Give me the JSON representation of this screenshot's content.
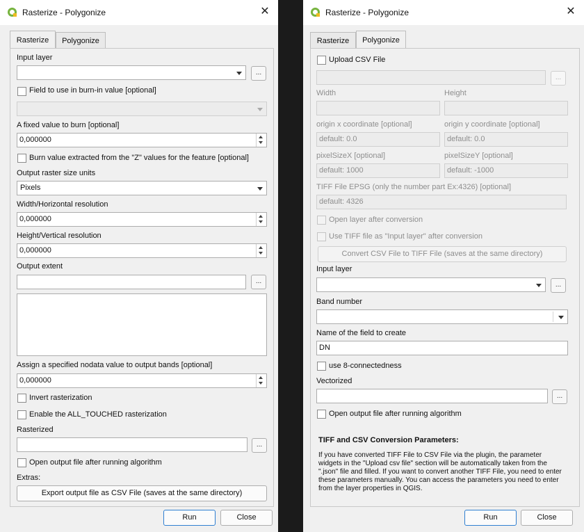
{
  "left_window": {
    "title": "Rasterize - Polygonize",
    "close_glyph": "✕",
    "tabs": [
      "Rasterize",
      "Polygonize"
    ],
    "input_layer_label": "Input layer",
    "input_layer_value": "",
    "browse_label": "...",
    "browse_extent_label": "...",
    "field_burn_label": "Field to use in burn-in value [optional]",
    "field_burn_value": "",
    "fixed_value_label": "A fixed value to burn [optional]",
    "fixed_value": "0,000000",
    "burn_z_label": "Burn value extracted from the \"Z\" values for the feature [optional]",
    "output_units_label": "Output raster size units",
    "output_units_value": "Pixels",
    "width_label": "Width/Horizontal resolution",
    "width_value": "0,000000",
    "height_label": "Height/Vertical resolution",
    "height_value": "0,000000",
    "extent_label": "Output extent",
    "extent_value": "",
    "nodata_label": "Assign a specified nodata value to output bands [optional]",
    "nodata_value": "0,000000",
    "invert_label": "Invert rasterization",
    "all_touched_label": "Enable the ALL_TOUCHED rasterization",
    "rasterized_label": "Rasterized",
    "rasterized_value": "",
    "open_output_label": "Open output file after running algorithm",
    "extras_label": "Extras:",
    "export_csv_label": "Export output file as CSV File (saves at the same directory)",
    "run_label": "Run",
    "close_label": "Close"
  },
  "right_window": {
    "title": "Rasterize - Polygonize",
    "close_glyph": "✕",
    "tabs": [
      "Rasterize",
      "Polygonize"
    ],
    "upload_csv_label": "Upload CSV File",
    "csv_path_value": "",
    "browse_label": "...",
    "width_label": "Width",
    "height_label": "Height",
    "origin_x_label": "origin x coordinate [optional]",
    "origin_x_placeholder": "default: 0.0",
    "origin_y_label": "origin y coordinate [optional]",
    "origin_y_placeholder": "default: 0.0",
    "pixel_x_label": "pixelSizeX [optional]",
    "pixel_x_placeholder": "default: 1000",
    "pixel_y_label": "pixelSizeY [optional]",
    "pixel_y_placeholder": "default: -1000",
    "epsg_label": "TIFF File EPSG (only the number part Ex:4326) [optional]",
    "epsg_placeholder": "default: 4326",
    "open_layer_label": "Open layer after conversion",
    "use_tiff_label": "Use TIFF file as \"Input layer\" after conversion",
    "convert_button_label": "Convert CSV File to TIFF File (saves at the same directory)",
    "input_layer_label": "Input layer",
    "band_number_label": "Band number",
    "field_name_label": "Name of the field to create",
    "field_name_value": "DN",
    "eight_conn_label": "use 8-connectedness",
    "vectorized_label": "Vectorized",
    "open_output_label": "Open output file after running algorithm",
    "info_title": "TIFF and CSV Conversion Parameters:",
    "info_text": "If you have converted TIFF File to CSV File via the plugin, the parameter widgets in the \"Upload csv file\" section will be automatically taken from the \".json\" file and filled. If you want to convert another TIFF File, you need to enter these parameters manually. You can access the parameters you need to enter from the layer properties in QGIS.",
    "run_label": "Run",
    "close_label": "Close"
  },
  "colors": {
    "qgis_green": "#77b43f",
    "primary_border": "#2f7fd1",
    "background": "#1b1b1b"
  }
}
